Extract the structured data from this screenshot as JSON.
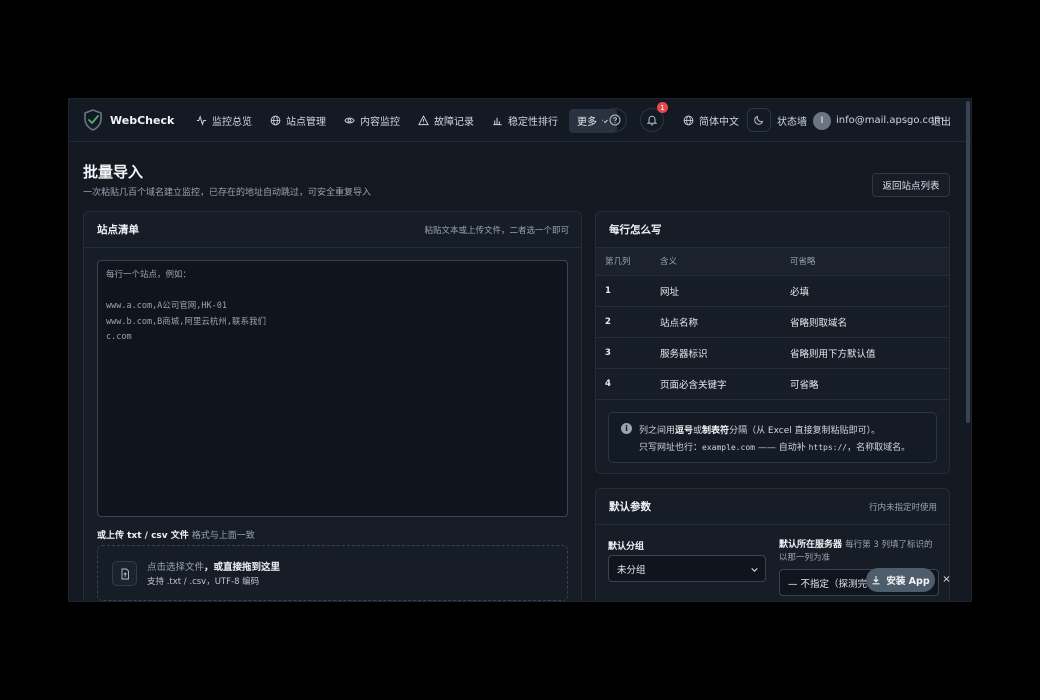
{
  "header": {
    "brand": "WebCheck",
    "nav": [
      {
        "label": "监控总览",
        "icon": "activity-icon"
      },
      {
        "label": "站点管理",
        "icon": "globe-icon"
      },
      {
        "label": "内容监控",
        "icon": "eye-icon"
      },
      {
        "label": "故障记录",
        "icon": "alert-triangle-icon"
      },
      {
        "label": "稳定性排行",
        "icon": "bar-chart-icon"
      }
    ],
    "more_label": "更多",
    "notification_count": "1",
    "language_label": "简体中文",
    "status_wall_label": "状态墙",
    "avatar_initial": "I",
    "user_email": "info@mail.apsgo.com",
    "logout_label": "退出"
  },
  "page": {
    "title": "批量导入",
    "subtitle": "一次粘贴几百个域名建立监控，已存在的地址自动跳过，可安全重复导入",
    "back_button": "返回站点列表"
  },
  "site_list": {
    "title": "站点清单",
    "hint": "粘贴文本或上传文件，二者选一个即可",
    "placeholder": "每行一个站点，例如：\n\nwww.a.com,A公司官网,HK-01\nwww.b.com,B商城,阿里云杭州,联系我们\nc.com",
    "upload_label": "或上传 txt / csv 文件",
    "upload_sublabel": "格式与上面一致",
    "drop_text": "点击选择文件",
    "drop_text_bold": "，或直接拖到这里",
    "drop_support": "支持 .txt / .csv，UTF-8 编码"
  },
  "format_help": {
    "title": "每行怎么写",
    "columns": [
      "第几列",
      "含义",
      "可省略"
    ],
    "rows": [
      [
        "1",
        "网址",
        "必填"
      ],
      [
        "2",
        "站点名称",
        "省略则取域名"
      ],
      [
        "3",
        "服务器标识",
        "省略则用下方默认值"
      ],
      [
        "4",
        "页面必含关键字",
        "可省略"
      ]
    ],
    "note_pre": "列之间用",
    "note_comma": "逗号",
    "note_or": "或",
    "note_tab": "制表符",
    "note_post": "分隔（从 Excel 直接复制粘贴即可）。",
    "note2_pre": "只写网址也行：",
    "note2_example": "example.com",
    "note2_mid": " —— 自动补 ",
    "note2_https": "https://",
    "note2_post": "，名称取域名。"
  },
  "defaults": {
    "title": "默认参数",
    "hint": "行内未指定时使用",
    "group_label": "默认分组",
    "group_value": "未分组",
    "server_label": "默认所在服务器",
    "server_sub": "每行第 3 列填了标识的以那一列为准",
    "server_value": "— 不指定（探测完"
  },
  "install": {
    "label": "安装 App",
    "close": "×"
  },
  "colors": {
    "background": "#131821",
    "panel": "#171d26",
    "accent_badge": "#e5484d",
    "brand_shield": "#4caf73"
  }
}
